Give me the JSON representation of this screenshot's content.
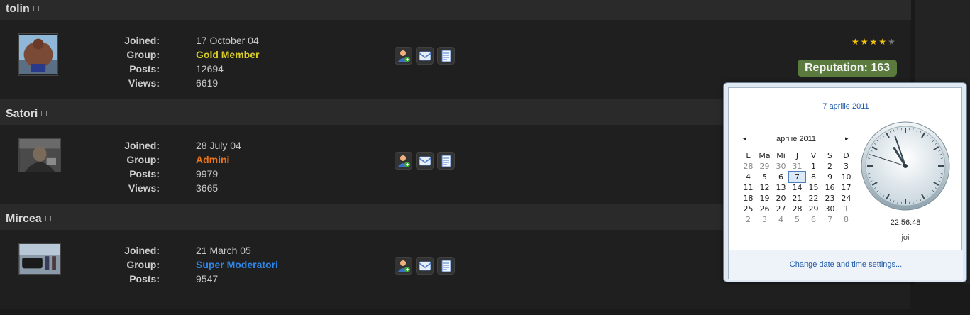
{
  "posts": [
    {
      "author": "tolin",
      "joined_label": "Joined:",
      "joined": "17 October 04",
      "group_label": "Group:",
      "group": "Gold Member",
      "posts_label": "Posts:",
      "posts": "12694",
      "views_label": "Views:",
      "views": "6619",
      "rating_stars": 4,
      "reputation": "Reputation: 163"
    },
    {
      "author": "Satori",
      "joined_label": "Joined:",
      "joined": "28 July 04",
      "group_label": "Group:",
      "group": "Admini",
      "posts_label": "Posts:",
      "posts": "9979",
      "views_label": "Views:",
      "views": "3665"
    },
    {
      "author": "Mircea",
      "joined_label": "Joined:",
      "joined": "21 March 05",
      "group_label": "Group:",
      "group": "Super Moderatori",
      "posts_label": "Posts:",
      "posts": "9547"
    }
  ],
  "colors": {
    "gold_member": "#d8cc28",
    "admin": "#e8731a",
    "super_moderator": "#2f86e8",
    "reputation_badge": "#5b7a3e"
  },
  "calendar": {
    "header_date": "7 aprilie 2011",
    "month_title": "aprilie 2011",
    "prev_icon": "◂",
    "next_icon": "▸",
    "weekdays": [
      "L",
      "Ma",
      "Mi",
      "J",
      "V",
      "S",
      "D"
    ],
    "weeks": [
      [
        "28",
        "29",
        "30",
        "31",
        "1",
        "2",
        "3"
      ],
      [
        "4",
        "5",
        "6",
        "7",
        "8",
        "9",
        "10"
      ],
      [
        "11",
        "12",
        "13",
        "14",
        "15",
        "16",
        "17"
      ],
      [
        "18",
        "19",
        "20",
        "21",
        "22",
        "23",
        "24"
      ],
      [
        "25",
        "26",
        "27",
        "28",
        "29",
        "30",
        "1"
      ],
      [
        "2",
        "3",
        "4",
        "5",
        "6",
        "7",
        "8"
      ]
    ],
    "selected_day": "7",
    "time": "22:56:48",
    "weekday_name": "joi",
    "footer_link": "Change date and time settings..."
  }
}
